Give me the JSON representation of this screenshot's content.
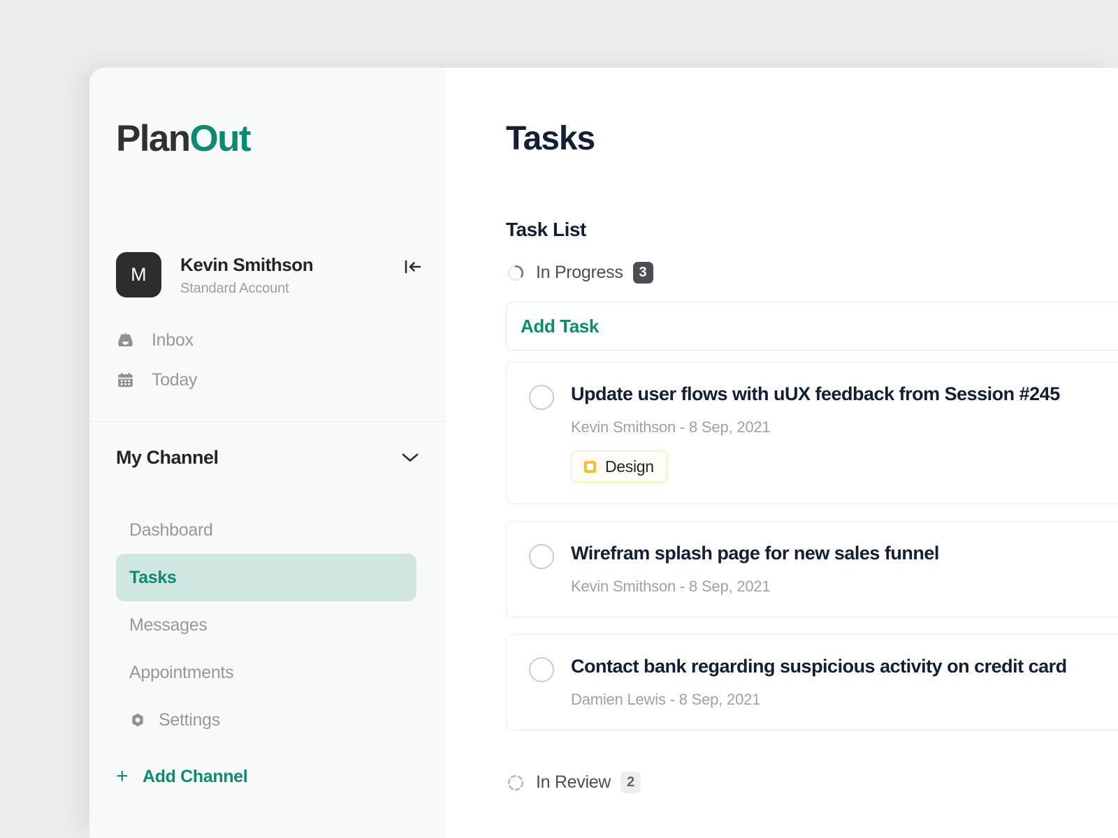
{
  "brand": {
    "part1": "Plan",
    "part2": "Out"
  },
  "account": {
    "avatar_initial": "M",
    "name": "Kevin Smithson",
    "subtitle": "Standard Account",
    "collapse_icon": "collapse-sidebar-icon"
  },
  "quicknav": [
    {
      "label": "Inbox",
      "icon": "inbox-icon"
    },
    {
      "label": "Today",
      "icon": "calendar-icon"
    }
  ],
  "channel": {
    "title": "My Channel",
    "chevron_icon": "chevron-down-icon",
    "items": [
      {
        "label": "Dashboard",
        "active": false,
        "icon": null
      },
      {
        "label": "Tasks",
        "active": true,
        "icon": null
      },
      {
        "label": "Messages",
        "active": false,
        "icon": null
      },
      {
        "label": "Appointments",
        "active": false,
        "icon": null
      },
      {
        "label": "Settings",
        "active": false,
        "icon": "gear-icon"
      }
    ],
    "add_channel_label": "Add Channel",
    "add_channel_plus": "+"
  },
  "main": {
    "page_title": "Tasks",
    "section_title": "Task List",
    "add_task_label": "Add Task",
    "groups": [
      {
        "label": "In Progress",
        "count": "3",
        "icon": "spinner-circle-icon",
        "badge_style": "dark"
      },
      {
        "label": "In Review",
        "count": "2",
        "icon": "dashed-circle-icon",
        "badge_style": "light"
      }
    ],
    "tasks": [
      {
        "title": "Update user flows with uUX feedback from Session #245",
        "meta": "Kevin Smithson - 8 Sep, 2021",
        "tags": [
          {
            "label": "Design",
            "color": "#f2c230"
          }
        ]
      },
      {
        "title": "Wirefram splash page for new sales funnel",
        "meta": "Kevin Smithson - 8 Sep, 2021",
        "tags": []
      },
      {
        "title": "Contact bank regarding suspicious activity on credit card",
        "meta": "Damien Lewis - 8 Sep, 2021",
        "tags": []
      }
    ]
  },
  "colors": {
    "accent": "#0c8a72",
    "active_nav_bg": "#cfe7e0",
    "sidebar_bg": "#f8f9f9",
    "page_bg": "#ededed",
    "title_text": "#131f33",
    "muted_text": "#95989c",
    "tag_yellow": "#f2c230"
  }
}
